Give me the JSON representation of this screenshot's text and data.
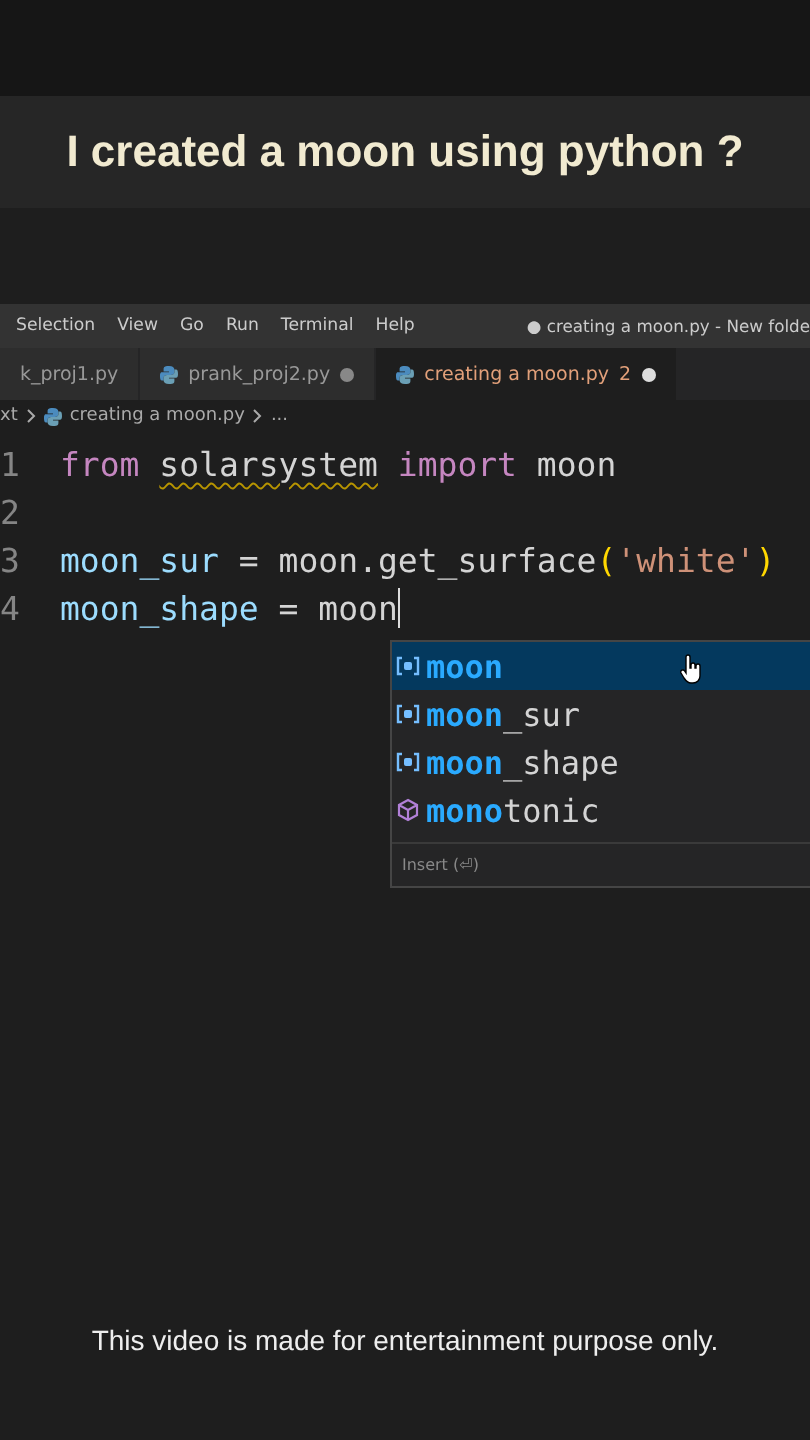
{
  "caption": "I created a moon using python ?",
  "menu": [
    "Selection",
    "View",
    "Go",
    "Run",
    "Terminal",
    "Help"
  ],
  "window_title": "● creating a moon.py - New folde",
  "tabs": [
    {
      "label": "k_proj1.py",
      "selected": false
    },
    {
      "label": "prank_proj2.py",
      "selected": false,
      "modified": true,
      "icon": true
    },
    {
      "label": "creating a moon.py",
      "selected": true,
      "modified": true,
      "icon": true,
      "problems": "2"
    }
  ],
  "breadcrumb": {
    "folder": "xt",
    "file": "creating a moon.py",
    "tail": "..."
  },
  "code_lines": [
    {
      "number": "1",
      "tokens": [
        {
          "kind": "keyword",
          "text": "from "
        },
        {
          "kind": "plain",
          "text": "solarsystem",
          "squiggle": true
        },
        {
          "kind": "keyword",
          "text": " import"
        },
        {
          "kind": "plain",
          "text": " moon"
        }
      ]
    },
    {
      "number": "2"
    },
    {
      "number": "3",
      "tokens": [
        {
          "kind": "variable",
          "text": "moon_sur"
        },
        {
          "kind": "plain",
          "text": " = moon.get_surface"
        },
        {
          "kind": "paren",
          "text": "("
        },
        {
          "kind": "string",
          "text": "'white'"
        },
        {
          "kind": "paren",
          "text": ")"
        }
      ]
    },
    {
      "number": "4",
      "cursor": true,
      "tokens": [
        {
          "kind": "variable",
          "text": "moon_shape"
        },
        {
          "kind": "plain",
          "text": " = moon"
        }
      ]
    }
  ],
  "suggestions": [
    {
      "kind": "variable",
      "match": "moon",
      "selected": true
    },
    {
      "kind": "variable",
      "match": "moon",
      "rest": "_sur",
      "selected": false
    },
    {
      "kind": "variable",
      "match": "moon",
      "rest": "_shape",
      "selected": false
    },
    {
      "kind": "module",
      "match": "mono",
      "rest": "tonic",
      "selected": false
    }
  ],
  "suggest_footer": "Insert (⏎)",
  "disclaimer": "This video is made for entertainment purpose only."
}
